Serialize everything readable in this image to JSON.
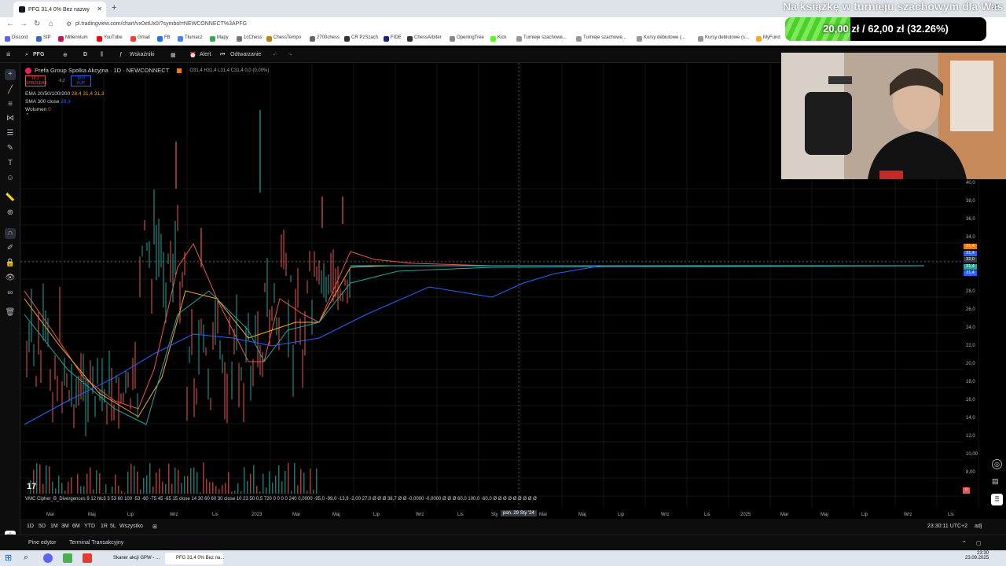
{
  "browser": {
    "tab_title": "PFG 31,4 0% Bez nazwy",
    "url": "pl.tradingview.com/chart/vx0xtUx0/?symbol=NEWCONNECT%3APFG",
    "bookmarks": [
      "Discord",
      "SIP",
      "Millennium",
      "YouTube",
      "Gmail",
      "FB",
      "Tłumacz",
      "Mapy",
      "1cChess",
      "ChessTempo",
      "2700chess",
      "CR PzSzach",
      "FIDE",
      "ChessArbiter",
      "OpeningTree",
      "Kick",
      "Turnieje szachowe...",
      "Turnieje szachowe...",
      "Kursy debiutowe (...",
      "Kursy debiutowe (s...",
      "MyFund"
    ]
  },
  "stream_overlay": {
    "banner": "Na książkę w turnieju szachowym dla Was",
    "progress_text": "20,00 zł / 62,00 zł (32.26%)",
    "progress_fraction": 0.3226,
    "progress_color": "#49d12a"
  },
  "toolbar": {
    "symbol": "PFG",
    "interval": "D",
    "indicators": "Wskaźniki",
    "alert": "Alert",
    "replay": "Odtwarzanie"
  },
  "legend": {
    "title": "Prefa Group Spolka Akcyjna · 1D · NEWCONNECT",
    "ohlc": "O31,4 H31,4 L31,4 C31,4 0,0 (0,00%)",
    "sell_price": "18,2",
    "sell_label": "SPRZEDAJ",
    "spread": "-6,2",
    "buy_price": "18,0",
    "buy_label": "KUP",
    "ema_label": "EMA 20/50/100/200",
    "ema_values": "28,4   31,4   31,3",
    "sma_label": "SMA 300 close",
    "sma_value": "29,3",
    "volume_label": "Wolumen",
    "volume_value": "0"
  },
  "price_labels": [
    "40,0",
    "38,0",
    "36,0",
    "34,0",
    "32,0",
    "30,0",
    "28,0",
    "26,0",
    "24,0",
    "22,0",
    "20,0",
    "18,0",
    "16,0",
    "14,0",
    "12,0",
    "10,00",
    "8,00"
  ],
  "price_tags": [
    {
      "text": "31,4",
      "color": "#f57c00"
    },
    {
      "text": "31,4",
      "color": "#2962ff"
    },
    {
      "text": "32,0",
      "color": "#363a45"
    },
    {
      "text": "31,4",
      "color": "#26a69a"
    },
    {
      "text": "31,4",
      "color": "#2962ff"
    }
  ],
  "indicator_row": "VMC Cipher_B_Divergences 9 12 hlc3 3 53 60 100 -53 -60 -75 45 -65 15 close 14 30 60 60 30 close 10 23 50 0,5 720 0 0 0 0 240 0,0000  -95,0  -99,0  -13,9        -2,00 27,0 Ø Ø Ø 38,7 Ø Ø -0,0000 -0,0000 Ø Ø Ø 60,0 100,0 -60,0 Ø Ø Ø Ø Ø Ø Ø Ø Ø",
  "time_labels": [
    "Mar",
    "Maj",
    "Lip",
    "Wrz",
    "Lis",
    "2023",
    "Mar",
    "Maj",
    "Lip",
    "Wrz",
    "Lis",
    "Sty",
    "Mar",
    "Maj",
    "Lip",
    "Wrz",
    "Lis",
    "2025",
    "Mar",
    "Maj",
    "Lip",
    "Wrz",
    "Lis"
  ],
  "crosshair_date": "pon. 29 Sty '24",
  "ranges": [
    "1D",
    "5D",
    "1M",
    "3M",
    "6M",
    "YTD",
    "1R",
    "5L",
    "Wszystko"
  ],
  "clock": "23:30:11 UTC+2",
  "adj": "adj",
  "panels": [
    "Pine edytor",
    "Terminal Transakcyjny"
  ],
  "taskbar": {
    "items": [
      "Skaner akcji GPW - ...",
      "PFG 31,4 0% Bez na..."
    ],
    "time": "23:30",
    "date": "23.09.2025"
  }
}
